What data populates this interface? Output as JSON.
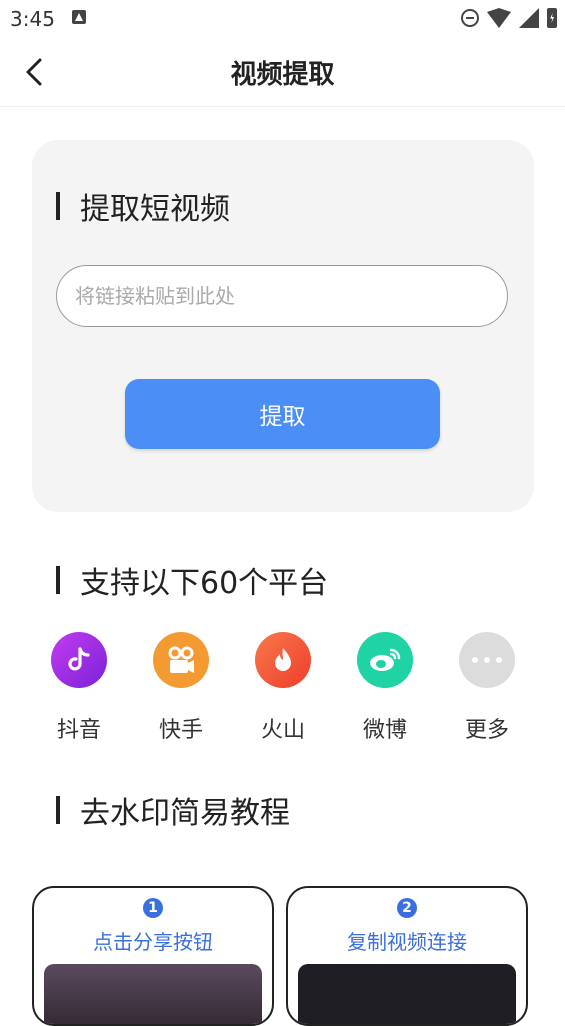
{
  "status_bar": {
    "time": "3:45"
  },
  "nav": {
    "title": "视频提取"
  },
  "extract": {
    "heading": "提取短视频",
    "input_placeholder": "将链接粘贴到此处",
    "button_label": "提取"
  },
  "platforms": {
    "heading": "支持以下60个平台",
    "items": [
      {
        "label": "抖音",
        "icon": "douyin-icon",
        "color": "#9b30e8"
      },
      {
        "label": "快手",
        "icon": "kuaishou-icon",
        "color": "#f39a32"
      },
      {
        "label": "火山",
        "icon": "huoshan-icon",
        "color": "#f25b3a"
      },
      {
        "label": "微博",
        "icon": "weibo-icon",
        "color": "#1fd3a5"
      },
      {
        "label": "更多",
        "icon": "more-icon",
        "color": "#dcdcdc"
      }
    ]
  },
  "tutorial": {
    "heading": "去水印简易教程",
    "steps": [
      {
        "number": "1",
        "text": "点击分享按钮"
      },
      {
        "number": "2",
        "text": "复制视频连接"
      }
    ]
  },
  "colors": {
    "accent": "#4a8ef6",
    "step_blue": "#3a6fe0"
  }
}
